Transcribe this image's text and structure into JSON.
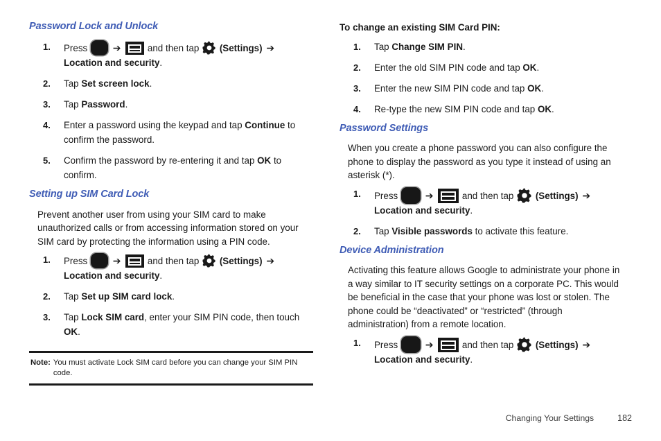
{
  "page": {
    "footer_title": "Changing Your Settings",
    "page_number": "182",
    "heading_color": "#3f5cb5"
  },
  "icons": {
    "home": "home-button-icon",
    "menu": "menu-key-icon",
    "gear": "settings-gear-icon",
    "arrow": "➔"
  },
  "left_column": {
    "section1": {
      "heading": "Password Lock and Unlock",
      "steps": [
        {
          "num": "1.",
          "press_label": "Press",
          "and_then_tap": "and then tap",
          "settings_paren": "(Settings)",
          "target": "Location and security",
          "period": "."
        },
        {
          "num": "2.",
          "pre": "Tap ",
          "bold": "Set screen lock",
          "post": "."
        },
        {
          "num": "3.",
          "pre": "Tap ",
          "bold": "Password",
          "post": "."
        },
        {
          "num": "4.",
          "pre": "Enter a password using the keypad and tap ",
          "bold": "Continue",
          "post": " to confirm the password."
        },
        {
          "num": "5.",
          "pre": "Confirm the password by re-entering it and tap ",
          "bold": "OK",
          "post": " to confirm."
        }
      ]
    },
    "section2": {
      "heading": "Setting up SIM Card Lock",
      "paragraph": "Prevent another user from using your SIM card to make unauthorized calls or from accessing information stored on your SIM card by protecting the information using a PIN code.",
      "steps": [
        {
          "num": "1.",
          "press_label": "Press",
          "and_then_tap": "and then tap",
          "settings_paren": "(Settings)",
          "target": "Location and security",
          "period": "."
        },
        {
          "num": "2.",
          "pre": "Tap ",
          "bold": "Set up SIM card lock",
          "post": "."
        },
        {
          "num": "3.",
          "pre": "Tap ",
          "bold": "Lock SIM card",
          "mid": ", enter your SIM PIN code, then touch ",
          "bold2": "OK",
          "post": "."
        }
      ]
    },
    "note": {
      "label": "Note:",
      "line1": "You must activate Lock SIM card before you can change your SIM PIN",
      "line2": "code."
    }
  },
  "right_column": {
    "section1": {
      "subheading": "To change an existing SIM Card PIN:",
      "steps": [
        {
          "num": "1.",
          "pre": "Tap ",
          "bold": "Change SIM PIN",
          "post": "."
        },
        {
          "num": "2.",
          "pre": "Enter the old SIM PIN code and tap ",
          "bold": "OK",
          "post": "."
        },
        {
          "num": "3.",
          "pre": "Enter the new SIM PIN code and tap ",
          "bold": "OK",
          "post": "."
        },
        {
          "num": "4.",
          "pre": "Re-type the new SIM PIN code and tap ",
          "bold": "OK",
          "post": "."
        }
      ]
    },
    "section2": {
      "heading": "Password Settings",
      "paragraph": "When you create a phone password you can also configure the phone to display the password as you type it instead of using an asterisk (*).",
      "steps": [
        {
          "num": "1.",
          "press_label": "Press",
          "and_then_tap": "and then tap",
          "settings_paren": "(Settings)",
          "target": "Location and security",
          "period": "."
        },
        {
          "num": "2.",
          "pre": "Tap ",
          "bold": "Visible passwords",
          "post": " to activate this feature."
        }
      ]
    },
    "section3": {
      "heading": "Device Administration",
      "paragraph": "Activating this feature allows Google to administrate your phone in a way similar to IT security settings on a corporate PC. This would be beneficial in the case that your phone was lost or stolen. The phone could be “deactivated” or “restricted” (through administration) from a remote location.",
      "steps": [
        {
          "num": "1.",
          "press_label": "Press",
          "and_then_tap": "and then tap",
          "settings_paren": "(Settings)",
          "target": "Location and security",
          "period": "."
        }
      ]
    }
  }
}
